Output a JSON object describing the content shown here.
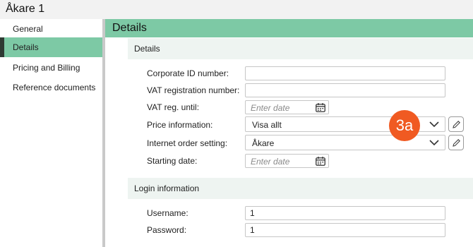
{
  "window": {
    "title": "Åkare 1"
  },
  "sidebar": {
    "items": [
      {
        "label": "General"
      },
      {
        "label": "Details",
        "active": true
      },
      {
        "label": "Pricing and Billing"
      },
      {
        "label": "Reference documents"
      }
    ]
  },
  "main": {
    "header": "Details"
  },
  "details_section": {
    "title": "Details",
    "corporate_id": {
      "label": "Corporate ID number:",
      "value": ""
    },
    "vat_number": {
      "label": "VAT registration number:",
      "value": ""
    },
    "vat_until": {
      "label": "VAT reg. until:",
      "placeholder": "Enter date"
    },
    "price_info": {
      "label": "Price information:",
      "value": "Visa allt"
    },
    "internet_order": {
      "label": "Internet order setting:",
      "value": "Åkare"
    },
    "starting_date": {
      "label": "Starting date:",
      "placeholder": "Enter date"
    }
  },
  "login_section": {
    "title": "Login information",
    "username": {
      "label": "Username:",
      "value": "1"
    },
    "password": {
      "label": "Password:",
      "value": "1"
    }
  },
  "annotation": {
    "badge": "3a",
    "color": "#f05a22"
  },
  "colors": {
    "accent": "#7dc9a5",
    "section_bg": "#eef4f1",
    "active_marker": "#2e3a33"
  }
}
